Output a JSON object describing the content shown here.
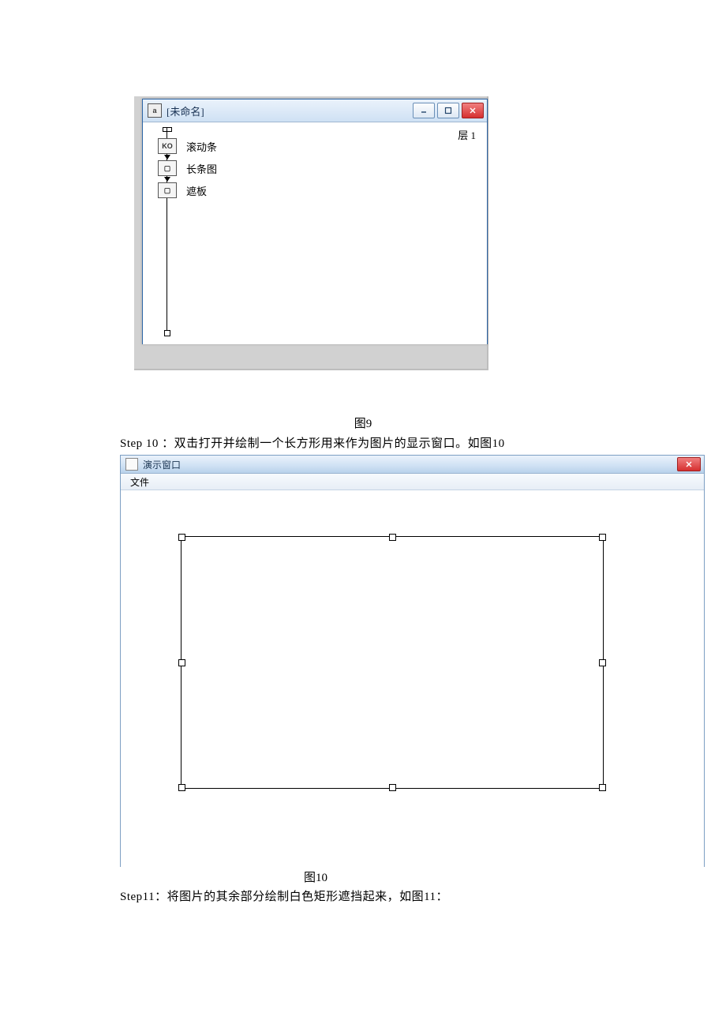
{
  "figure9": {
    "caption": "图9",
    "window": {
      "title": "[未命名]",
      "layer_label": "层 1",
      "nodes": [
        {
          "icon": "KO",
          "label": "滚动条"
        },
        {
          "icon": "▢",
          "label": "长条图"
        },
        {
          "icon": "▢",
          "label": "遮板"
        }
      ]
    }
  },
  "step10": {
    "text": "Step 10 ：双击打开并绘制一个长方形用来作为图片的显示窗口。如图10"
  },
  "figure10": {
    "caption": "图10",
    "window": {
      "title": "演示窗口",
      "menu": {
        "file": "文件"
      }
    }
  },
  "step11": {
    "text": "Step11：将图片的其余部分绘制白色矩形遮挡起来，如图11："
  }
}
